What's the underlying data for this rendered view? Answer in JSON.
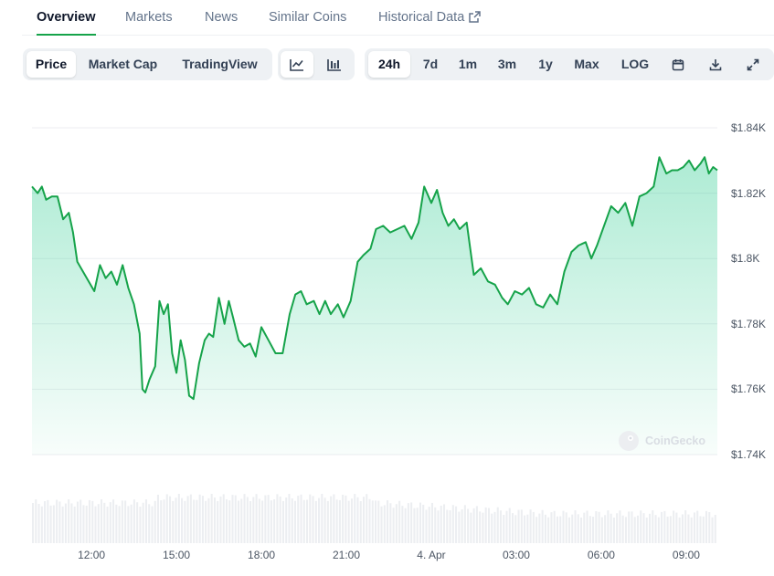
{
  "tabs": [
    {
      "label": "Overview",
      "active": true
    },
    {
      "label": "Markets"
    },
    {
      "label": "News"
    },
    {
      "label": "Similar Coins"
    },
    {
      "label": "Historical Data",
      "external": true
    }
  ],
  "chart_type_buttons": [
    {
      "label": "Price",
      "selected": true
    },
    {
      "label": "Market Cap"
    },
    {
      "label": "TradingView"
    }
  ],
  "view_buttons": [
    {
      "icon": "line-chart-icon",
      "selected": true
    },
    {
      "icon": "candlestick-chart-icon"
    }
  ],
  "range_buttons": [
    {
      "label": "24h",
      "selected": true
    },
    {
      "label": "7d"
    },
    {
      "label": "1m"
    },
    {
      "label": "3m"
    },
    {
      "label": "1y"
    },
    {
      "label": "Max"
    },
    {
      "label": "LOG"
    }
  ],
  "tool_icons": [
    "calendar-icon",
    "download-icon",
    "fullscreen-icon"
  ],
  "watermark": "CoinGecko",
  "colors": {
    "line": "#16a34a",
    "fill": "#16c784",
    "volume": "#eceef1",
    "active_tab": "#16a34a"
  },
  "chart_data": {
    "type": "area",
    "title": "",
    "xlabel": "",
    "ylabel": "",
    "ylim": [
      1.735,
      1.84
    ],
    "y_ticks": [
      "$1.84K",
      "$1.82K",
      "$1.8K",
      "$1.78K",
      "$1.76K",
      "$1.74K"
    ],
    "x_ticks": [
      "12:00",
      "15:00",
      "18:00",
      "21:00",
      "4. Apr",
      "03:00",
      "06:00",
      "09:00"
    ],
    "x_tick_hours": [
      12,
      15,
      18,
      21,
      24,
      27,
      30,
      33
    ],
    "x_range_hours": [
      9.9,
      34.1
    ],
    "grid": true,
    "series": [
      {
        "x": [
          9.9,
          10.1,
          10.25,
          10.4,
          10.6,
          10.8,
          11.0,
          11.2,
          11.35,
          11.5,
          11.7,
          11.9,
          12.1,
          12.3,
          12.5,
          12.7,
          12.9,
          13.1,
          13.3,
          13.5,
          13.7,
          13.8,
          13.9,
          14.05,
          14.25,
          14.4,
          14.55,
          14.7,
          14.85,
          15.0,
          15.15,
          15.3,
          15.45,
          15.6,
          15.8,
          16.0,
          16.15,
          16.3,
          16.5,
          16.7,
          16.85,
          17.0,
          17.2,
          17.4,
          17.6,
          17.8,
          18.0,
          18.25,
          18.5,
          18.75,
          19.0,
          19.2,
          19.4,
          19.6,
          19.85,
          20.05,
          20.25,
          20.45,
          20.7,
          20.9,
          21.15,
          21.4,
          21.6,
          21.85,
          22.05,
          22.3,
          22.55,
          22.8,
          23.05,
          23.3,
          23.55,
          23.75,
          24.0,
          24.2,
          24.4,
          24.6,
          24.8,
          25.0,
          25.25,
          25.5,
          25.75,
          26.0,
          26.25,
          26.5,
          26.7,
          26.95,
          27.2,
          27.45,
          27.7,
          27.95,
          28.2,
          28.45,
          28.7,
          28.95,
          29.2,
          29.45,
          29.65,
          29.85,
          30.1,
          30.35,
          30.6,
          30.85,
          31.1,
          31.35,
          31.6,
          31.85,
          32.05,
          32.3,
          32.5,
          32.7,
          32.9,
          33.1,
          33.3,
          33.5,
          33.65,
          33.8,
          33.95,
          34.1
        ],
        "values": [
          1.822,
          1.82,
          1.822,
          1.818,
          1.819,
          1.819,
          1.812,
          1.814,
          1.808,
          1.799,
          1.796,
          1.793,
          1.79,
          1.798,
          1.794,
          1.796,
          1.792,
          1.798,
          1.791,
          1.786,
          1.777,
          1.76,
          1.759,
          1.763,
          1.767,
          1.787,
          1.783,
          1.786,
          1.771,
          1.765,
          1.775,
          1.769,
          1.758,
          1.757,
          1.768,
          1.775,
          1.777,
          1.776,
          1.788,
          1.78,
          1.787,
          1.782,
          1.775,
          1.773,
          1.774,
          1.77,
          1.779,
          1.775,
          1.771,
          1.771,
          1.783,
          1.789,
          1.79,
          1.786,
          1.787,
          1.783,
          1.787,
          1.783,
          1.786,
          1.782,
          1.787,
          1.799,
          1.801,
          1.803,
          1.809,
          1.81,
          1.808,
          1.809,
          1.81,
          1.806,
          1.811,
          1.822,
          1.817,
          1.821,
          1.814,
          1.81,
          1.812,
          1.809,
          1.811,
          1.795,
          1.797,
          1.793,
          1.792,
          1.788,
          1.786,
          1.79,
          1.789,
          1.791,
          1.786,
          1.785,
          1.789,
          1.786,
          1.796,
          1.802,
          1.804,
          1.805,
          1.8,
          1.804,
          1.81,
          1.816,
          1.814,
          1.817,
          1.81,
          1.819,
          1.82,
          1.822,
          1.831,
          1.826,
          1.827,
          1.827,
          1.828,
          1.83,
          1.827,
          1.829,
          1.831,
          1.826,
          1.828,
          1.827
        ]
      }
    ],
    "volume_baseline": true
  }
}
